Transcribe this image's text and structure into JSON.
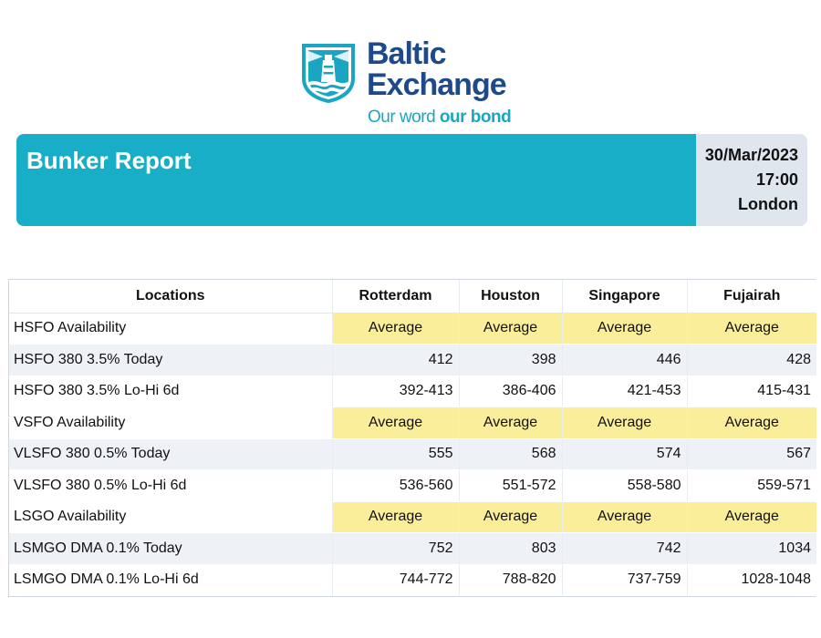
{
  "logo": {
    "name_line1": "Baltic",
    "name_line2": "Exchange",
    "tagline_light": "Our word ",
    "tagline_bold": "our bond",
    "colors": {
      "navy": "#1e4a8c",
      "teal": "#1aa6c3"
    }
  },
  "header": {
    "title": "Bunker Report",
    "date": "30/Mar/2023",
    "time": "17:00",
    "place": "London",
    "colors": {
      "bar": "#18aec7",
      "meta": "#dfe6ee"
    }
  },
  "table": {
    "columns": [
      "Locations",
      "Rotterdam",
      "Houston",
      "Singapore",
      "Fujairah"
    ],
    "rows": [
      {
        "label": "HSFO Availability",
        "type": "availability",
        "values": [
          "Average",
          "Average",
          "Average",
          "Average"
        ]
      },
      {
        "label": "HSFO 380 3.5% Today",
        "type": "today",
        "values": [
          "412",
          "398",
          "446",
          "428"
        ]
      },
      {
        "label": "HSFO 380 3.5% Lo-Hi 6d",
        "type": "range",
        "values": [
          "392-413",
          "386-406",
          "421-453",
          "415-431"
        ]
      },
      {
        "label": "VSFO Availability",
        "type": "availability",
        "values": [
          "Average",
          "Average",
          "Average",
          "Average"
        ]
      },
      {
        "label": "VLSFO 380 0.5% Today",
        "type": "today",
        "values": [
          "555",
          "568",
          "574",
          "567"
        ]
      },
      {
        "label": "VLSFO 380 0.5% Lo-Hi 6d",
        "type": "range",
        "values": [
          "536-560",
          "551-572",
          "558-580",
          "559-571"
        ]
      },
      {
        "label": "LSGO Availability",
        "type": "availability",
        "values": [
          "Average",
          "Average",
          "Average",
          "Average"
        ]
      },
      {
        "label": "LSMGO DMA 0.1% Today",
        "type": "today",
        "values": [
          "752",
          "803",
          "742",
          "1034"
        ]
      },
      {
        "label": "LSMGO DMA 0.1% Lo-Hi 6d",
        "type": "range",
        "values": [
          "744-772",
          "788-820",
          "737-759",
          "1028-1048"
        ]
      }
    ],
    "colors": {
      "availability": "#fbee9a",
      "shade": "#eef2f6"
    }
  }
}
